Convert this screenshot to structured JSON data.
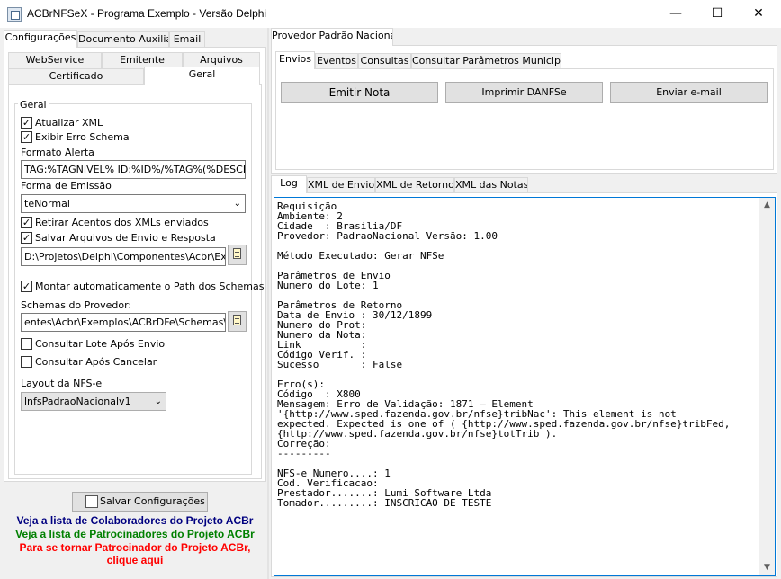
{
  "window": {
    "title": "ACBrNFSeX - Programa Exemplo - Versão Delphi",
    "minimize": "—",
    "maximize": "☐",
    "close": "✕"
  },
  "left_tabs": [
    "Configurações",
    "Documento Auxiliar",
    "Email"
  ],
  "config_tabs_row1": [
    "WebService",
    "Emitente",
    "Arquivos"
  ],
  "config_tabs_row2": [
    "Certificado",
    "Geral"
  ],
  "geral": {
    "group_title": "Geral",
    "atualizar_xml": "Atualizar XML",
    "exibir_erro_schema": "Exibir Erro Schema",
    "formato_alerta_label": "Formato Alerta",
    "formato_alerta_value": "TAG:%TAGNIVEL% ID:%ID%/%TAG%(%DESCRI",
    "forma_emissao_label": "Forma de Emissão",
    "forma_emissao_value": "teNormal",
    "retirar_acentos": "Retirar Acentos dos XMLs enviados",
    "salvar_arquivos": "Salvar Arquivos de Envio e Resposta",
    "path_salvar": "D:\\Projetos\\Delphi\\Componentes\\Acbr\\Exempl",
    "montar_path": "Montar automaticamente o Path dos Schemas",
    "schemas_label": "Schemas do Provedor:",
    "schemas_value": "entes\\Acbr\\Exemplos\\ACBrDFe\\Schemas\\NFSe",
    "consultar_lote": "Consultar Lote Após Envio",
    "consultar_cancelar": "Consultar Após Cancelar",
    "layout_label": "Layout da NFS-e",
    "layout_value": "lnfsPadraoNacionalv1"
  },
  "salvar_button": "Salvar Configurações",
  "links": {
    "colaboradores": "Veja a lista de Colaboradores do Projeto ACBr",
    "patrocinadores": "Veja a lista de Patrocinadores do Projeto ACBr",
    "tornar_patrocinador_1": "Para se tornar Patrocinador do Projeto ACBr,",
    "tornar_patrocinador_2": "clique aqui"
  },
  "provider_tab": "Provedor Padrão Nacional",
  "action_tabs": [
    "Envios",
    "Eventos",
    "Consultas",
    "Consultar Parâmetros Municipais"
  ],
  "buttons": {
    "emitir": "Emitir Nota",
    "imprimir": "Imprimir DANFSe",
    "enviar_email": "Enviar e-mail"
  },
  "log_tabs": [
    "Log",
    "XML de Envio",
    "XML de Retorno",
    "XML das Notas"
  ],
  "log_text": "Requisição\nAmbiente: 2\nCidade  : Brasilia/DF\nProvedor: PadraoNacional Versão: 1.00\n\nMétodo Executado: Gerar NFSe\n\nParâmetros de Envio\nNumero do Lote: 1\n\nParâmetros de Retorno\nData de Envio : 30/12/1899\nNumero do Prot:\nNumero da Nota:\nLink          :\nCódigo Verif. :\nSucesso       : False\n\nErro(s):\nCódigo  : X800\nMensagem: Erro de Validação: 1871 – Element\n'{http://www.sped.fazenda.gov.br/nfse}tribNac': This element is not\nexpected. Expected is one of ( {http://www.sped.fazenda.gov.br/nfse}tribFed,\n{http://www.sped.fazenda.gov.br/nfse}totTrib ).\nCorreção:\n---------\n\nNFS-e Numero....: 1\nCod. Verificacao:\nPrestador.......: Lumi Software Ltda\nTomador.........: INSCRICAO DE TESTE",
  "colors": {
    "link_blue": "#000080",
    "link_green": "#008000",
    "link_red": "#ff0000",
    "focus_border": "#0078d7"
  }
}
